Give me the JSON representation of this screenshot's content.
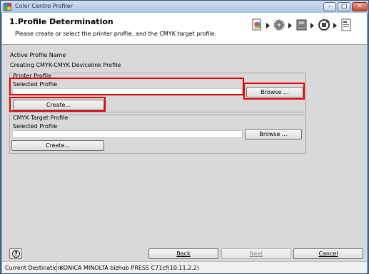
{
  "window": {
    "title": "Color Centro Profiler",
    "minimize": "–",
    "maximize": "□",
    "close": "✕"
  },
  "header": {
    "title": "1.Profile Determination",
    "subtitle": "Please create or select the printer profile, and the CMYK target profile.",
    "steps": [
      {
        "icon": "profile-select-icon"
      },
      {
        "icon": "settings-gear-icon"
      },
      {
        "icon": "printer-icon"
      },
      {
        "icon": "color-sync-icon"
      },
      {
        "icon": "document-icon"
      }
    ]
  },
  "active_profile": {
    "label": "Active Profile Name",
    "value": "Creating CMYK-CMYK Devicelink Profile"
  },
  "printer_profile": {
    "group_label": "Printer Profile",
    "selected_label": "Selected Profile",
    "selected_value": "",
    "browse_label": "Browse ...",
    "create_label": "Create..."
  },
  "cmyk_target_profile": {
    "group_label": "CMYK Target Profile",
    "selected_label": "Selected Profile",
    "selected_value": "",
    "browse_label": "Browse ...",
    "create_label": "Create..."
  },
  "footer": {
    "help_label": "?",
    "back_label": "Back",
    "next_label": "Next",
    "cancel_label": "Cancel"
  },
  "status": {
    "label": "Current Destination",
    "value": "KONICA MINOLTA bizhub PRESS C71cf(10.11.2.2)"
  },
  "colors": {
    "highlight": "#e60000",
    "panel": "#d9d9d9",
    "frame": "#6f8fb3"
  }
}
